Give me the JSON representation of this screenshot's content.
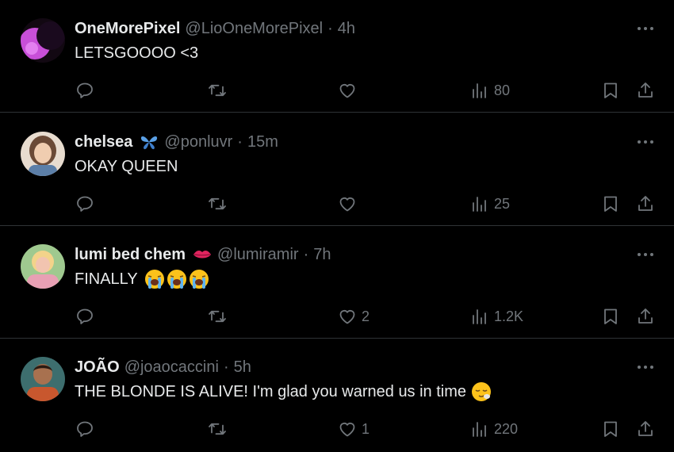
{
  "tweets": [
    {
      "name": "OneMorePixel",
      "handle": "@LioOneMorePixel",
      "dot": "·",
      "time": "4h",
      "text": "LETSGOOOO <3",
      "likes": "",
      "views": "80",
      "avatar_colors": [
        "#c84fd8",
        "#1a0a1e"
      ]
    },
    {
      "name": "chelsea",
      "handle": "@ponluvr",
      "dot": "·",
      "time": "15m",
      "text": "OKAY QUEEN",
      "likes": "",
      "views": "25",
      "badge_icon": "butterfly-icon",
      "avatar_colors": [
        "#d9b89a",
        "#5c7fa8"
      ]
    },
    {
      "name": "lumi bed chem",
      "handle": "@lumiramir",
      "dot": "·",
      "time": "7h",
      "text": "FINALLY",
      "likes": "2",
      "views": "1.2K",
      "badge_icon": "lips-icon",
      "text_emojis": [
        "loudly-crying-face-icon",
        "loudly-crying-face-icon",
        "loudly-crying-face-icon"
      ],
      "avatar_colors": [
        "#e8a0b4",
        "#7ab37a"
      ]
    },
    {
      "name": "JOÃO",
      "handle": "@joaocaccini",
      "dot": "·",
      "time": "5h",
      "text": "THE BLONDE IS ALIVE! I'm glad you warned us in time",
      "likes": "1",
      "views": "220",
      "text_emojis": [
        "relieved-face-icon"
      ],
      "avatar_colors": [
        "#3d6e6e",
        "#c8572e"
      ]
    }
  ],
  "colors": {
    "background": "#000000",
    "text": "#e7e9ea",
    "muted": "#71767b",
    "divider": "#2f3336"
  }
}
